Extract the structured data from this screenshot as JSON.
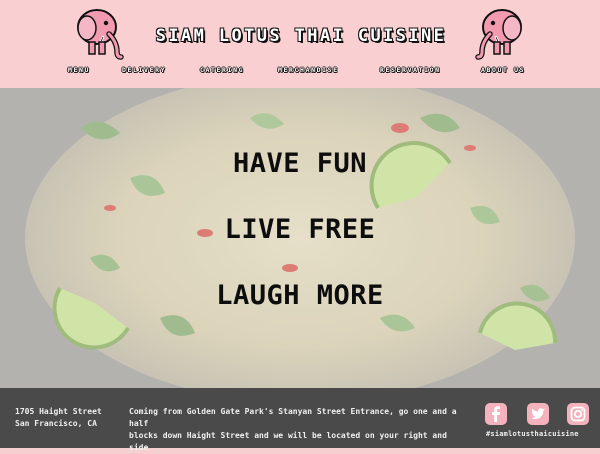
{
  "header": {
    "title": "SIAM LOTUS THAI CUISINE",
    "nav": [
      {
        "label": "MENU"
      },
      {
        "label": "DELIVERY"
      },
      {
        "label": "CATERING"
      },
      {
        "label": "MERCHANDISE"
      },
      {
        "label": "RESERVATION"
      },
      {
        "label": "ABOUT US"
      }
    ],
    "logo_icon": "elephant-icon",
    "brand_pink": "#f9cfd1",
    "elephant_pink": "#f29bb0"
  },
  "hero": {
    "slogans": [
      "HAVE FUN",
      "LIVE FREE",
      "LAUGH MORE"
    ]
  },
  "footer": {
    "address_line1": "1705 Haight Street",
    "address_line2": "San Francisco, CA",
    "directions_line1": "Coming from Golden Gate Park's Stanyan Street Entrance, go one and a half",
    "directions_line2": "blocks down Haight Street and we will be located on your right and side",
    "hashtag": "#siamlotusthaicuisine",
    "social": [
      {
        "icon": "facebook-icon"
      },
      {
        "icon": "twitter-icon"
      },
      {
        "icon": "instagram-icon"
      }
    ],
    "background": "#4a4a4a",
    "social_pink": "#f4b3bc"
  }
}
